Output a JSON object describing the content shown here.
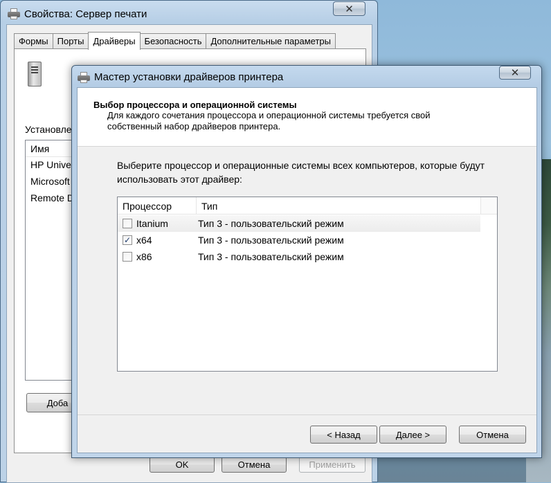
{
  "server_window": {
    "title": "Свойства: Сервер печати",
    "close_label": "✕",
    "tabs": [
      {
        "label": "Формы"
      },
      {
        "label": "Порты"
      },
      {
        "label": "Драйверы"
      },
      {
        "label": "Безопасность"
      },
      {
        "label": "Дополнительные параметры"
      }
    ],
    "installed_label": "Установле",
    "list_header": "Имя",
    "drivers": [
      {
        "name": "HP Unive"
      },
      {
        "name": "Microsoft"
      },
      {
        "name": "Remote D"
      }
    ],
    "add_button": "Доба",
    "ok": "OK",
    "cancel": "Отмена",
    "apply": "Применить"
  },
  "wizard": {
    "title": "Мастер установки драйверов принтера",
    "close_label": "✕",
    "header_title": "Выбор процессора и операционной системы",
    "header_subtitle": "Для каждого сочетания процессора и операционной системы требуется свой собственный набор драйверов принтера.",
    "instructions": "Выберите процессор и операционные системы всех компьютеров, которые будут использовать этот драйвер:",
    "columns": {
      "processor": "Процессор",
      "type": "Тип"
    },
    "rows": [
      {
        "processor": "Itanium",
        "type": "Тип 3 - пользовательский режим",
        "checked": false
      },
      {
        "processor": "x64",
        "type": "Тип 3 - пользовательский режим",
        "checked": true
      },
      {
        "processor": "x86",
        "type": "Тип 3 - пользовательский режим",
        "checked": false
      }
    ],
    "back": "< Назад",
    "next": "Далее >",
    "cancel": "Отмена"
  }
}
